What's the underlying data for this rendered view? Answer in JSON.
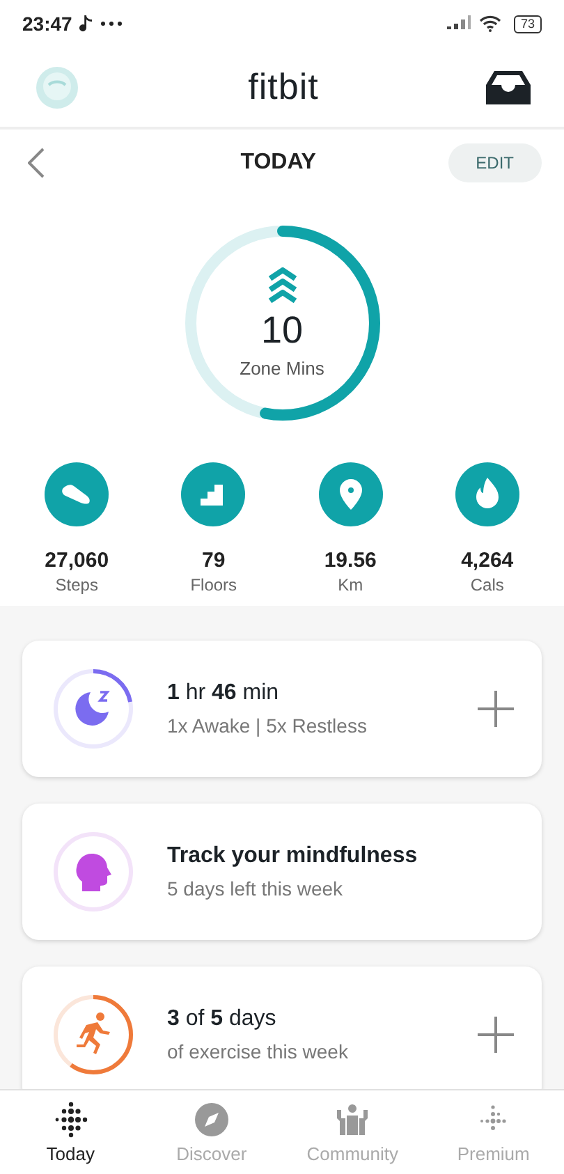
{
  "status_bar": {
    "time": "23:47",
    "battery": "73"
  },
  "header": {
    "title": "fitbit"
  },
  "day_bar": {
    "title": "TODAY",
    "edit": "EDIT"
  },
  "zone": {
    "value": "10",
    "label": "Zone Mins"
  },
  "stats": [
    {
      "kind": "steps",
      "value": "27,060",
      "label": "Steps"
    },
    {
      "kind": "floors",
      "value": "79",
      "label": "Floors"
    },
    {
      "kind": "distance",
      "value": "19.56",
      "label": "Km"
    },
    {
      "kind": "calories",
      "value": "4,264",
      "label": "Cals"
    }
  ],
  "cards": [
    {
      "kind": "sleep",
      "title": "**1** hr **46** min",
      "subtitle": "1x Awake | 5x Restless"
    },
    {
      "kind": "mindfulness",
      "title": "Track your mindfulness",
      "subtitle": "5 days left this week"
    },
    {
      "kind": "exercise",
      "title": "**3** of **5** days",
      "subtitle": "of exercise this week"
    }
  ],
  "nav": [
    {
      "kind": "today",
      "label": "Today",
      "selected": true
    },
    {
      "kind": "discover",
      "label": "Discover",
      "selected": false
    },
    {
      "kind": "community",
      "label": "Community",
      "selected": false
    },
    {
      "kind": "premium",
      "label": "Premium",
      "selected": false
    }
  ]
}
